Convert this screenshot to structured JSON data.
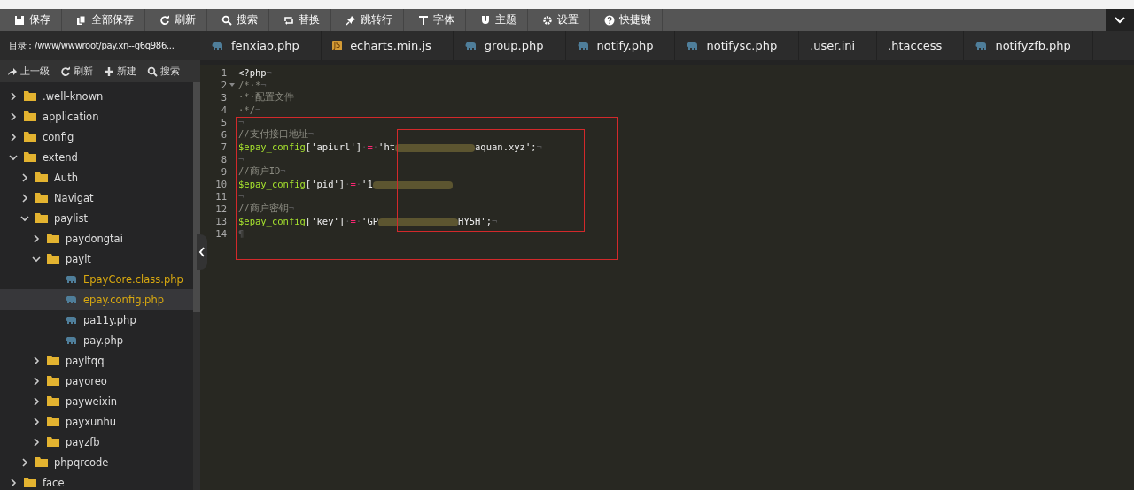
{
  "toolbar": [
    {
      "label": "保存"
    },
    {
      "label": "全部保存"
    },
    {
      "label": "刷新"
    },
    {
      "label": "搜索"
    },
    {
      "label": "替换"
    },
    {
      "label": "跳转行"
    },
    {
      "label": "字体"
    },
    {
      "label": "主题"
    },
    {
      "label": "设置"
    },
    {
      "label": "快捷键"
    }
  ],
  "directory": {
    "label": "目录：/www/wwwroot/pay.xn--g6q986..."
  },
  "tabs": [
    {
      "kind": "php",
      "label": "fenxiao.php",
      "selected": false
    },
    {
      "kind": "js",
      "icon_text": "JS",
      "label": "echarts.min.js",
      "selected": false
    },
    {
      "kind": "php",
      "label": "group.php",
      "selected": false
    },
    {
      "kind": "php",
      "label": "notify.php",
      "selected": false
    },
    {
      "kind": "php",
      "label": "notifysc.php",
      "selected": false
    },
    {
      "kind": "plain",
      "label": ".user.ini",
      "selected": false
    },
    {
      "kind": "plain",
      "label": ".htaccess",
      "selected": false
    },
    {
      "kind": "php",
      "label": "notifyzfb.php",
      "selected": false
    }
  ],
  "sidebar_actions": [
    {
      "label": "上一级"
    },
    {
      "label": "刷新"
    },
    {
      "label": "新建"
    },
    {
      "label": "搜索"
    }
  ],
  "tree": [
    {
      "kind": "folder",
      "label": ".well-known",
      "expanded": false
    },
    {
      "kind": "folder",
      "label": "application",
      "expanded": false
    },
    {
      "kind": "folder",
      "label": "config",
      "expanded": false
    },
    {
      "kind": "folder",
      "label": "extend",
      "expanded": true,
      "children": [
        {
          "kind": "folder",
          "label": "Auth",
          "expanded": false
        },
        {
          "kind": "folder",
          "label": "Navigat",
          "expanded": false
        },
        {
          "kind": "folder",
          "label": "paylist",
          "expanded": true,
          "children": [
            {
              "kind": "folder",
              "label": "paydongtai",
              "expanded": false
            },
            {
              "kind": "folder",
              "label": "paylt",
              "expanded": true,
              "children": [
                {
                  "kind": "file",
                  "label": "EpayCore.class.php",
                  "open": true,
                  "selected": false
                },
                {
                  "kind": "file",
                  "label": "epay.config.php",
                  "open": true,
                  "selected": true
                },
                {
                  "kind": "file",
                  "label": "pa11y.php",
                  "open": false,
                  "selected": false
                },
                {
                  "kind": "file",
                  "label": "pay.php",
                  "open": false,
                  "selected": false
                }
              ]
            },
            {
              "kind": "folder",
              "label": "payltqq",
              "expanded": false
            },
            {
              "kind": "folder",
              "label": "payoreo",
              "expanded": false
            },
            {
              "kind": "folder",
              "label": "payweixin",
              "expanded": false
            },
            {
              "kind": "folder",
              "label": "payxunhu",
              "expanded": false
            },
            {
              "kind": "folder",
              "label": "payzfb",
              "expanded": false
            }
          ]
        },
        {
          "kind": "folder",
          "label": "phpqrcode",
          "expanded": false
        }
      ]
    },
    {
      "kind": "folder",
      "label": "face",
      "expanded": false
    }
  ],
  "editor": {
    "lines": [
      {
        "number": "1",
        "tokens": [
          {
            "kind": "tag",
            "text": "<?php"
          },
          {
            "kind": "ws",
            "text": "¬"
          }
        ]
      },
      {
        "number": "2",
        "fold": true,
        "tokens": [
          {
            "kind": "comment",
            "text": "/*·*"
          },
          {
            "kind": "ws",
            "text": "¬"
          }
        ]
      },
      {
        "number": "3",
        "tokens": [
          {
            "kind": "comment",
            "text": "·*·配置文件"
          },
          {
            "kind": "ws",
            "text": "¬"
          }
        ]
      },
      {
        "number": "4",
        "tokens": [
          {
            "kind": "comment",
            "text": "·*/"
          },
          {
            "kind": "ws",
            "text": "¬"
          }
        ]
      },
      {
        "number": "5",
        "tokens": [
          {
            "kind": "ws",
            "text": "¬"
          }
        ]
      },
      {
        "number": "6",
        "tokens": [
          {
            "kind": "comment",
            "text": "//支付接口地址"
          },
          {
            "kind": "ws",
            "text": "¬"
          }
        ]
      },
      {
        "number": "7",
        "tokens": [
          {
            "kind": "var",
            "text": "$epay_config"
          },
          {
            "kind": "plain",
            "text": "['apiurl']"
          },
          {
            "kind": "ws",
            "text": "·"
          },
          {
            "kind": "op",
            "text": "="
          },
          {
            "kind": "ws",
            "text": "·"
          },
          {
            "kind": "plain",
            "text": "'ht"
          },
          {
            "kind": "redacted"
          },
          {
            "kind": "plain",
            "text": "aquan.xyz';"
          },
          {
            "kind": "ws",
            "text": "¬"
          }
        ]
      },
      {
        "number": "8",
        "tokens": [
          {
            "kind": "ws",
            "text": "¬"
          }
        ]
      },
      {
        "number": "9",
        "tokens": [
          {
            "kind": "comment",
            "text": "//商户ID"
          },
          {
            "kind": "ws",
            "text": "¬"
          }
        ]
      },
      {
        "number": "10",
        "tokens": [
          {
            "kind": "var",
            "text": "$epay_config"
          },
          {
            "kind": "plain",
            "text": "['pid']"
          },
          {
            "kind": "ws",
            "text": "·"
          },
          {
            "kind": "op",
            "text": "="
          },
          {
            "kind": "ws",
            "text": "·"
          },
          {
            "kind": "plain",
            "text": "'1"
          },
          {
            "kind": "redacted"
          }
        ]
      },
      {
        "number": "11",
        "tokens": [
          {
            "kind": "ws",
            "text": "¬"
          }
        ]
      },
      {
        "number": "12",
        "tokens": [
          {
            "kind": "comment",
            "text": "//商户密钥"
          },
          {
            "kind": "ws",
            "text": "¬"
          }
        ]
      },
      {
        "number": "13",
        "tokens": [
          {
            "kind": "var",
            "text": "$epay_config"
          },
          {
            "kind": "plain",
            "text": "['key']"
          },
          {
            "kind": "ws",
            "text": "·"
          },
          {
            "kind": "op",
            "text": "="
          },
          {
            "kind": "ws",
            "text": "·"
          },
          {
            "kind": "plain",
            "text": "'GP"
          },
          {
            "kind": "redacted"
          },
          {
            "kind": "plain",
            "text": "HY5H';"
          },
          {
            "kind": "ws",
            "text": "¬"
          }
        ]
      },
      {
        "number": "14",
        "tokens": [
          {
            "kind": "ws",
            "text": "¶"
          }
        ]
      }
    ]
  }
}
